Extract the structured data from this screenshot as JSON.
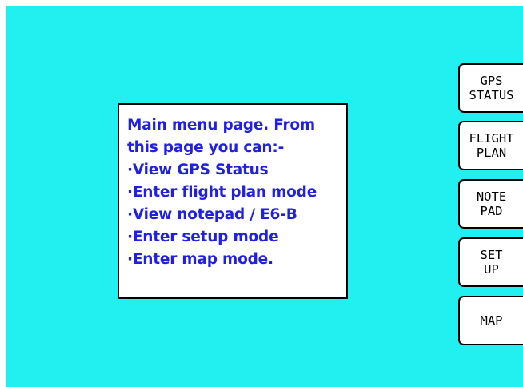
{
  "info_panel": {
    "lines": [
      "Main menu page. From",
      "this page you can:-",
      "·View GPS Status",
      "·Enter flight plan mode",
      "·View notepad / E6-B",
      "·Enter setup mode",
      "·Enter map mode."
    ]
  },
  "menu": {
    "gps_status": [
      "GPS",
      "STATUS"
    ],
    "flight_plan": [
      "FLIGHT",
      "PLAN"
    ],
    "notepad": [
      "NOTE",
      "PAD"
    ],
    "setup": [
      "SET",
      "UP"
    ],
    "map": [
      "MAP"
    ]
  },
  "colors": {
    "screen_background": "#22f0f0",
    "panel_text": "#1f1fe6",
    "panel_background": "#ffffff",
    "button_background": "#ffffff",
    "border": "#000000"
  }
}
